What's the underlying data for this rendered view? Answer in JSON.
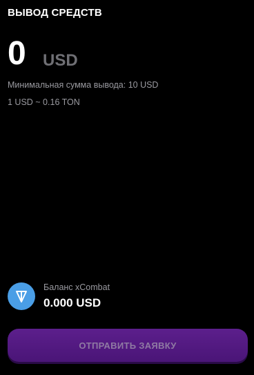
{
  "header": {
    "title": "ВЫВОД СРЕДСТВ"
  },
  "amount": {
    "value": "0",
    "currency": "USD"
  },
  "info": {
    "min_sum": "Минимальная сумма вывода: 10 USD",
    "rate": "1 USD ~ 0.16 TON"
  },
  "balance": {
    "icon": "ton-icon",
    "label": "Баланс xCombat",
    "amount": "0.000 USD"
  },
  "submit": {
    "label": "ОТПРАВИТЬ ЗАЯВКУ"
  },
  "colors": {
    "background": "#000000",
    "ton_blue": "#4a9ee6",
    "button_purple": "#5c1f8c",
    "button_text": "#8f7aa3",
    "muted_text": "#9a9aa0",
    "currency_gray": "#6f6f74"
  }
}
